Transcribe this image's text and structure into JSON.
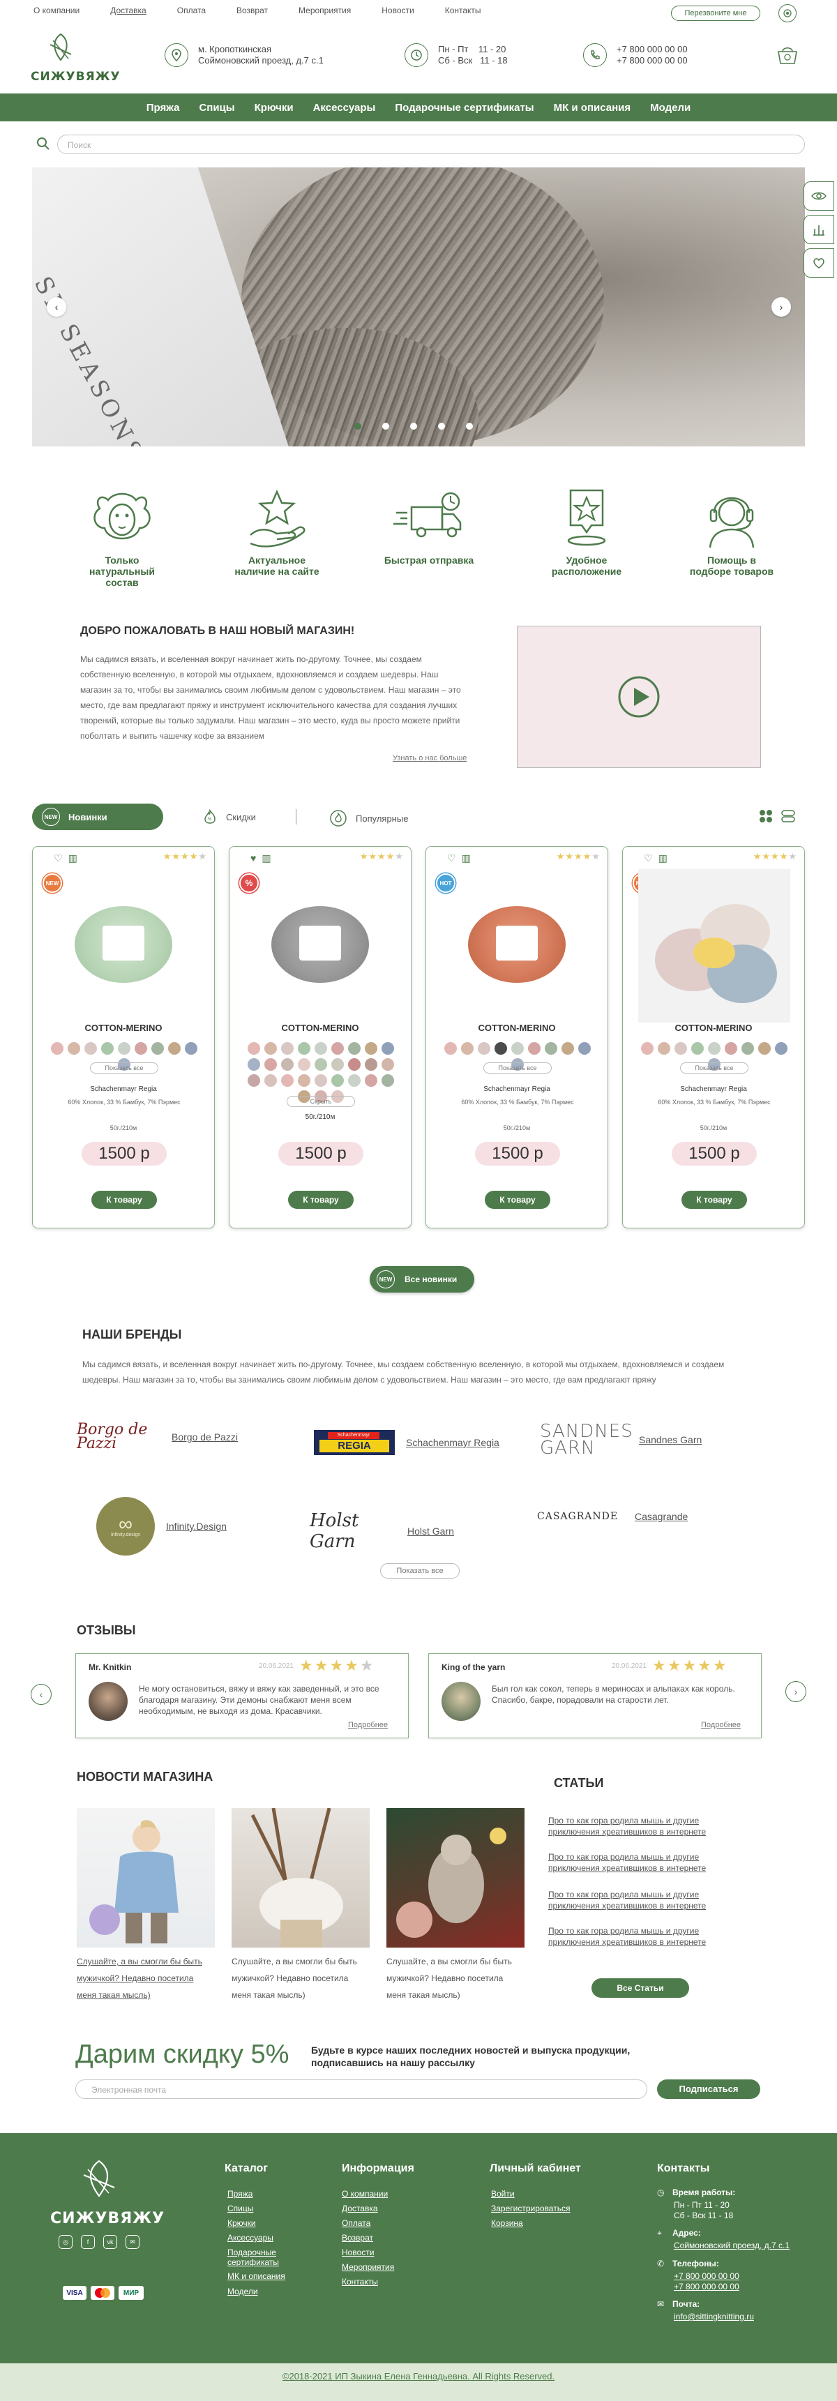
{
  "topnav": [
    "О компании",
    "Доставка",
    "Оплата",
    "Возврат",
    "Мероприятия",
    "Новости",
    "Контакты"
  ],
  "callback_label": "Перезвоните мне",
  "logo": "СИЖУВЯЖУ",
  "address": {
    "line1": "м. Кропоткинская",
    "line2": "Соймоновский проезд, д.7 с.1"
  },
  "hours": {
    "row1_days": "Пн - Пт",
    "row1_time": "11 - 20",
    "row2_days": "Сб - Вск",
    "row2_time": "11 - 18"
  },
  "phones": [
    "+7 800 000 00 00",
    "+7 800 000 00 00"
  ],
  "mainnav": [
    "Пряжа",
    "Спицы",
    "Крючки",
    "Аксессуары",
    "Подарочные сертификаты",
    "МК и описания",
    "Модели"
  ],
  "search_placeholder": "Поиск",
  "hero": {
    "brand_text": "SE SEASONS",
    "slides": 5,
    "active_slide": 0
  },
  "features": [
    {
      "icon": "sheep-icon",
      "label": "Только натуральный состав"
    },
    {
      "icon": "star-hand-icon",
      "label": "Актуальное наличие на сайте"
    },
    {
      "icon": "delivery-truck-icon",
      "label": "Быстрая отправка"
    },
    {
      "icon": "location-pin-icon",
      "label": "Удобное расположение"
    },
    {
      "icon": "support-headset-icon",
      "label": "Помощь в подборе товаров"
    }
  ],
  "welcome": {
    "title": "ДОБРО ПОЖАЛОВАТЬ В НАШ НОВЫЙ МАГАЗИН!",
    "text": "Мы садимся вязать, и вселенная вокруг начинает жить по-другому. Точнее, мы создаем собственную вселенную, в которой мы отдыхаем, вдохновляемся и создаем шедевры. Наш магазин за то, чтобы вы занимались своим любимым делом с удовольствием. Наш магазин – это место, где вам предлагают пряжу и инструмент исключительного качества для создания лучших творений, которые вы только задумали. Наш магазин – это место, куда вы просто можете прийти поболтать и выпить чашечку кофе за вязанием",
    "more": "Узнать о нас больше"
  },
  "tabs": {
    "active": "Новинки",
    "discounts": "Скидки",
    "popular": "Популярные"
  },
  "products": [
    {
      "name": "COTTON-MERINO",
      "brand": "Schachenmayr Regia",
      "composition": "60% Хлопок, 33 % Бамбук, 7% Пэрмес",
      "length": "50г./210м",
      "price": "1500 р",
      "button": "К товару",
      "toggle": "Показать все",
      "badge": "NEW",
      "favorite": false
    },
    {
      "name": "COTTON-MERINO",
      "brand": "Schachenmayr Regia",
      "composition": "60% Хлопок, 33 % Бамбук, 7% Пэрмес",
      "length": "50г./210м",
      "price": "1500 р",
      "button": "К товару",
      "toggle": "Скрыть",
      "badge": "%",
      "favorite": true
    },
    {
      "name": "COTTON-MERINO",
      "brand": "Schachenmayr Regia",
      "composition": "60% Хлопок, 33 % Бамбук, 7% Пэрмес",
      "length": "50г./210м",
      "price": "1500 р",
      "button": "К товару",
      "toggle": "Показать все",
      "badge": "HOT",
      "favorite": false
    },
    {
      "name": "COTTON-MERINO",
      "brand": "Schachenmayr Regia",
      "composition": "60% Хлопок, 33 % Бамбук, 7% Пэрмес",
      "length": "50г./210м",
      "price": "1500 р",
      "button": "К товару",
      "toggle": "Показать все",
      "badge": "NEW",
      "favorite": false
    }
  ],
  "all_new": "Все новинки",
  "brands": {
    "title": "НАШИ БРЕНДЫ",
    "text": "Мы садимся вязать, и вселенная вокруг начинает жить по-другому. Точнее, мы создаем собственную вселенную, в которой мы отдыхаем, вдохновляемся и создаем шедевры. Наш магазин за то, чтобы вы занимались своим любимым делом с удовольствием. Наш магазин – это место, где вам предлагают пряжу",
    "items": [
      "Borgo de Pazzi",
      "Schachenmayr Regia",
      "Sandnes Garn",
      "Infinity.Design",
      "Holst Garn",
      "Casagrande"
    ],
    "logos": {
      "borgo": "Borgo de Pazzi",
      "regia_top": "Schachenmayr",
      "regia": "REGIA",
      "sandnes": "SANDNES GARN",
      "infinity": "Infinity.design",
      "holst": "Holst Garn",
      "casagrande": "CASAGRANDE"
    },
    "show_all": "Показать все"
  },
  "reviews": {
    "title": "ОТЗЫВЫ",
    "items": [
      {
        "name": "Mr. Knitkin",
        "date": "20.06.2021",
        "text": "Не могу остановиться, вяжу и вяжу как заведенный, и это все благодаря магазину. Эти демоны снабжают меня всем необходимым, не выходя из дома. Красавчики.",
        "more": "Подробнее"
      },
      {
        "name": "King of the yarn",
        "date": "20.06.2021",
        "text": "Был гол как сокол, теперь в мериносах и альпаках как король. Спасибо, бакре, порадовали на старости лет.",
        "more": "Подробнее"
      }
    ]
  },
  "news": {
    "title": "НОВОСТИ МАГАЗИНА",
    "items": [
      "Слушайте, а вы смогли бы быть мужичкой? Недавно посетила меня такая мысль)",
      "Слушайте, а вы смогли бы быть мужичкой? Недавно посетила меня такая мысль)",
      "Слушайте, а вы смогли бы быть мужичкой? Недавно посетила меня такая мысль)"
    ]
  },
  "articles": {
    "title": "СТАТЬИ",
    "items": [
      "Про то как гора родила мышь и другие приключения хреатившиков в интернете",
      "Про то как гора родила мышь и другие приключения хреатившиков в интернете",
      "Про то как гора родила мышь и другие приключения хреатившиков в интернете",
      "Про то как гора родила мышь и другие приключения хреатившиков в интернете"
    ],
    "all": "Все Статьи"
  },
  "discount": {
    "title": "Дарим скидку 5%",
    "text": "Будьте в курсе наших последних новостей и выпуска продукции, подписавшись на нашу рассылку",
    "placeholder": "Электронная почта",
    "button": "Подписаться"
  },
  "footer": {
    "catalog": {
      "title": "Каталог",
      "links": [
        "Пряжа",
        "Спицы",
        "Крючки",
        "Аксессуары",
        "Подарочные сертификаты",
        "МК и описания",
        "Модели"
      ]
    },
    "info": {
      "title": "Информация",
      "links": [
        "О компании",
        "Доставка",
        "Оплата",
        "Возврат",
        "Новости",
        "Мероприятия",
        "Контакты"
      ]
    },
    "account": {
      "title": "Личный кабинет",
      "links": [
        "Войти",
        "Зарегистрироваться",
        "Корзина"
      ]
    },
    "contacts": {
      "title": "Контакты",
      "hours_label": "Время работы:",
      "hours1": "Пн - Пт 11 - 20",
      "hours2": "Сб - Вск 11 - 18",
      "address_label": "Адрес:",
      "address": "Соймоновский проезд, д.7 с.1",
      "phone_label": "Телефоны:",
      "phone1": "+7 800 000 00 00",
      "phone2": "+7 800 000 00 00",
      "email_label": "Почта:",
      "email": "info@sittingknitting.ru"
    },
    "payments": [
      "VISA",
      "MasterCard",
      "МИР"
    ],
    "copyright": "©2018-2021 ИП Зыкина Елена Геннадьевна. All Rights Reserved."
  },
  "colors": {
    "brand_green": "#4e7b4c",
    "price_pink": "#f6e0e4",
    "star_gold": "#e8c860",
    "hot_orange": "#e97a40"
  }
}
